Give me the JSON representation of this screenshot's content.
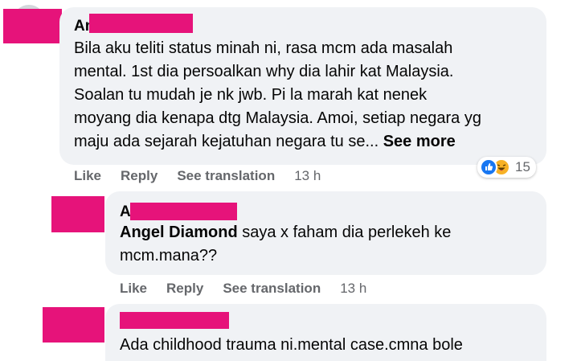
{
  "comments": [
    {
      "author_visible": "An",
      "body_lines": [
        "Bila aku teliti status minah ni, rasa mcm ada masalah",
        "mental. 1st dia persoalkan why dia lahir kat Malaysia.",
        "Soalan tu mudah je nk jwb. Pi la marah kat nenek",
        "moyang dia kenapa dtg Malaysia. Amoi, setiap negara yg",
        "maju ada sejarah kejatuhan negara tu se..."
      ],
      "see_more": "See more",
      "actions": {
        "like": "Like",
        "reply": "Reply",
        "see_translation": "See translation",
        "time": "13 h"
      },
      "reactions": {
        "icons": [
          "like-icon",
          "haha-icon"
        ],
        "count": "15"
      }
    },
    {
      "author_visible": "A",
      "mention": "Angel Diamond",
      "body_lines_after_mention": " saya x faham dia perlekeh ke",
      "body_line_2": "mcm.mana??",
      "actions": {
        "like": "Like",
        "reply": "Reply",
        "see_translation": "See translation",
        "time": "13 h"
      }
    },
    {
      "body": "Ada childhood trauma ni.mental case.cmna bole"
    }
  ],
  "colors": {
    "redaction": "#e6137a",
    "bubble": "#f0f2f5",
    "text": "#050505",
    "meta": "#65676b",
    "like_blue": "#1877f2",
    "haha_yellow": "#f7b125"
  }
}
